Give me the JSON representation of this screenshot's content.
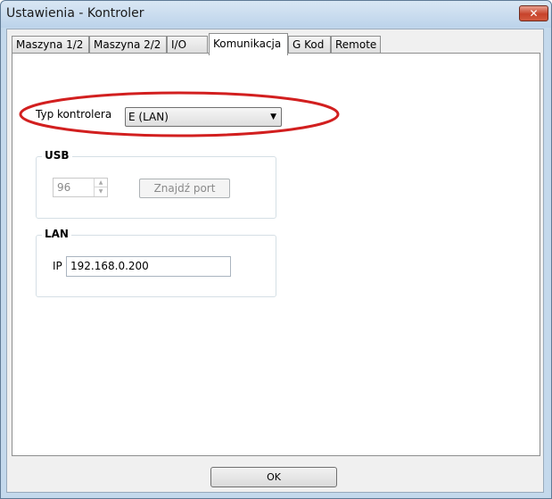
{
  "window": {
    "title": "Ustawienia - Kontroler",
    "close_glyph": "✕"
  },
  "tabs": [
    {
      "label": "Maszyna 1/2"
    },
    {
      "label": "Maszyna 2/2"
    },
    {
      "label": "I/O"
    },
    {
      "label": "Komunikacja",
      "active": true
    },
    {
      "label": "G Kod"
    },
    {
      "label": "Remote"
    }
  ],
  "controller_type": {
    "label": "Typ kontrolera",
    "selected": "E (LAN)",
    "arrow": "▼"
  },
  "usb": {
    "legend": "USB",
    "port_value": "96",
    "up_glyph": "▲",
    "down_glyph": "▼",
    "find_port_label": "Znajdź port"
  },
  "lan": {
    "legend": "LAN",
    "ip_label": "IP",
    "ip_value": "192.168.0.200"
  },
  "footer": {
    "ok_label": "OK"
  },
  "annotation": {
    "color": "#d21f1f"
  }
}
